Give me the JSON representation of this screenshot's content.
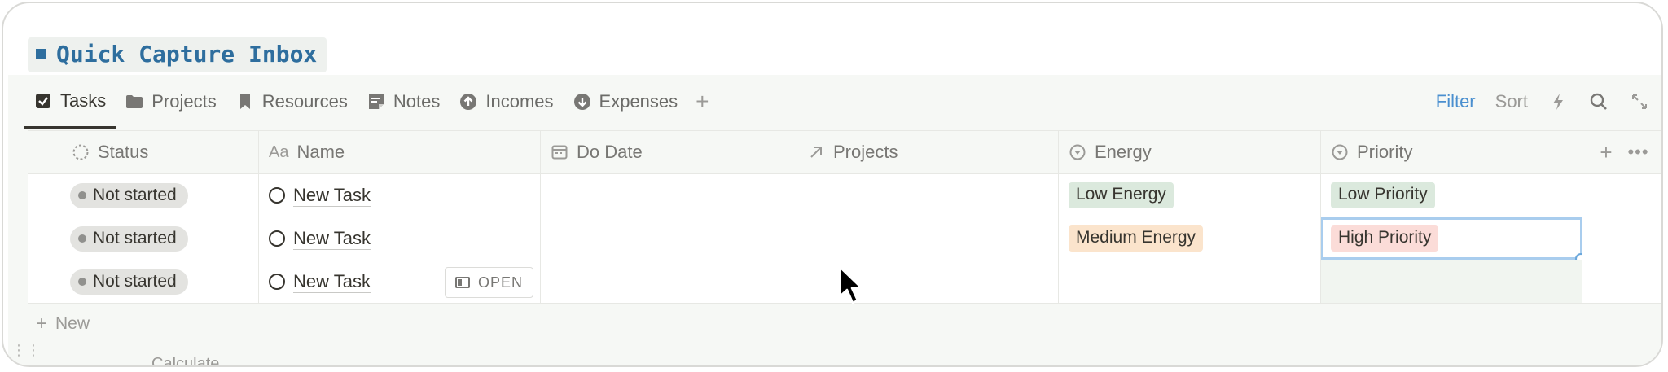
{
  "page": {
    "title": "Quick Capture Inbox"
  },
  "tabs": [
    {
      "label": "Tasks",
      "icon": "checkbox-icon",
      "active": true
    },
    {
      "label": "Projects",
      "icon": "folder-icon",
      "active": false
    },
    {
      "label": "Resources",
      "icon": "bookmark-icon",
      "active": false
    },
    {
      "label": "Notes",
      "icon": "note-icon",
      "active": false
    },
    {
      "label": "Incomes",
      "icon": "arrow-up-circle-icon",
      "active": false
    },
    {
      "label": "Expenses",
      "icon": "arrow-down-circle-icon",
      "active": false
    }
  ],
  "toolbar": {
    "filter_label": "Filter",
    "sort_label": "Sort",
    "automation_icon": "lightning-icon",
    "search_icon": "search-icon",
    "expand_icon": "expand-icon",
    "filter_color": "#4a8fcf"
  },
  "columns": {
    "status": "Status",
    "name": "Name",
    "name_prefix": "Aa",
    "do_date": "Do Date",
    "projects": "Projects",
    "energy": "Energy",
    "priority": "Priority"
  },
  "rows": [
    {
      "status": "Not started",
      "name": "New Task",
      "do_date": "",
      "projects": "",
      "energy": "Low Energy",
      "priority": "Low Priority"
    },
    {
      "status": "Not started",
      "name": "New Task",
      "do_date": "",
      "projects": "",
      "energy": "Medium Energy",
      "priority": "High Priority"
    },
    {
      "status": "Not started",
      "name": "New Task",
      "do_date": "",
      "projects": "",
      "energy": "",
      "priority": ""
    }
  ],
  "row_actions": {
    "open_label": "OPEN"
  },
  "footer": {
    "new_label": "New",
    "calculate_label": "Calculate"
  },
  "colors": {
    "low": "#dbe9dd",
    "medium": "#fbe4cc",
    "high": "#fbdcd8",
    "title": "#2e6e9e"
  }
}
